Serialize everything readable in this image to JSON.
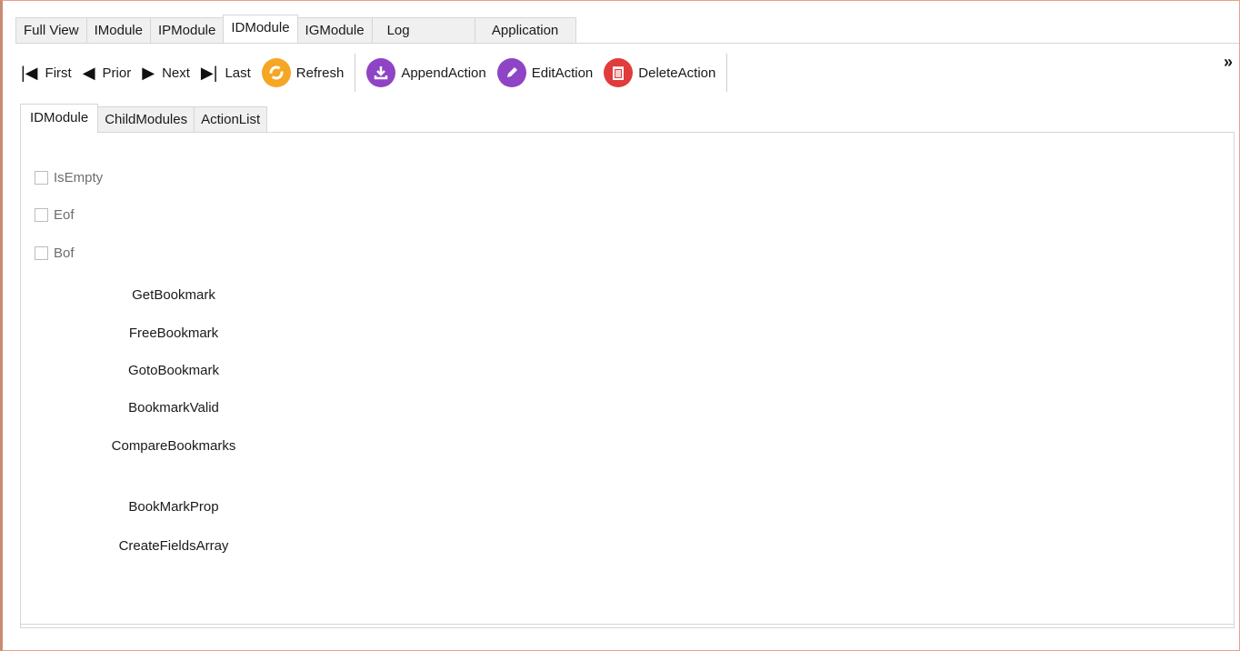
{
  "main_tabs": [
    "Full View",
    "IModule",
    "IPModule",
    "IDModule",
    "IGModule",
    "Log",
    "Application"
  ],
  "active_main_tab": "IDModule",
  "toolbar": {
    "first": "First",
    "prior": "Prior",
    "next": "Next",
    "last": "Last",
    "refresh": "Refresh",
    "append": "AppendAction",
    "edit": "EditAction",
    "delete": "DeleteAction",
    "overflow": "»"
  },
  "inner_tabs": [
    "IDModule",
    "ChildModules",
    "ActionList"
  ],
  "checkboxes": [
    {
      "label": "IsEmpty",
      "checked": false
    },
    {
      "label": "Eof",
      "checked": false
    },
    {
      "label": "Bof",
      "checked": false
    }
  ],
  "commands": [
    "GetBookmark",
    "FreeBookmark",
    "GotoBookmark",
    "BookmarkValid",
    "CompareBookmarks",
    "BookMarkProp",
    "CreateFieldsArray"
  ],
  "colors": {
    "refresh": "#f5a623",
    "append": "#8e44c4",
    "edit": "#8e44c4",
    "delete": "#e23b3b"
  }
}
